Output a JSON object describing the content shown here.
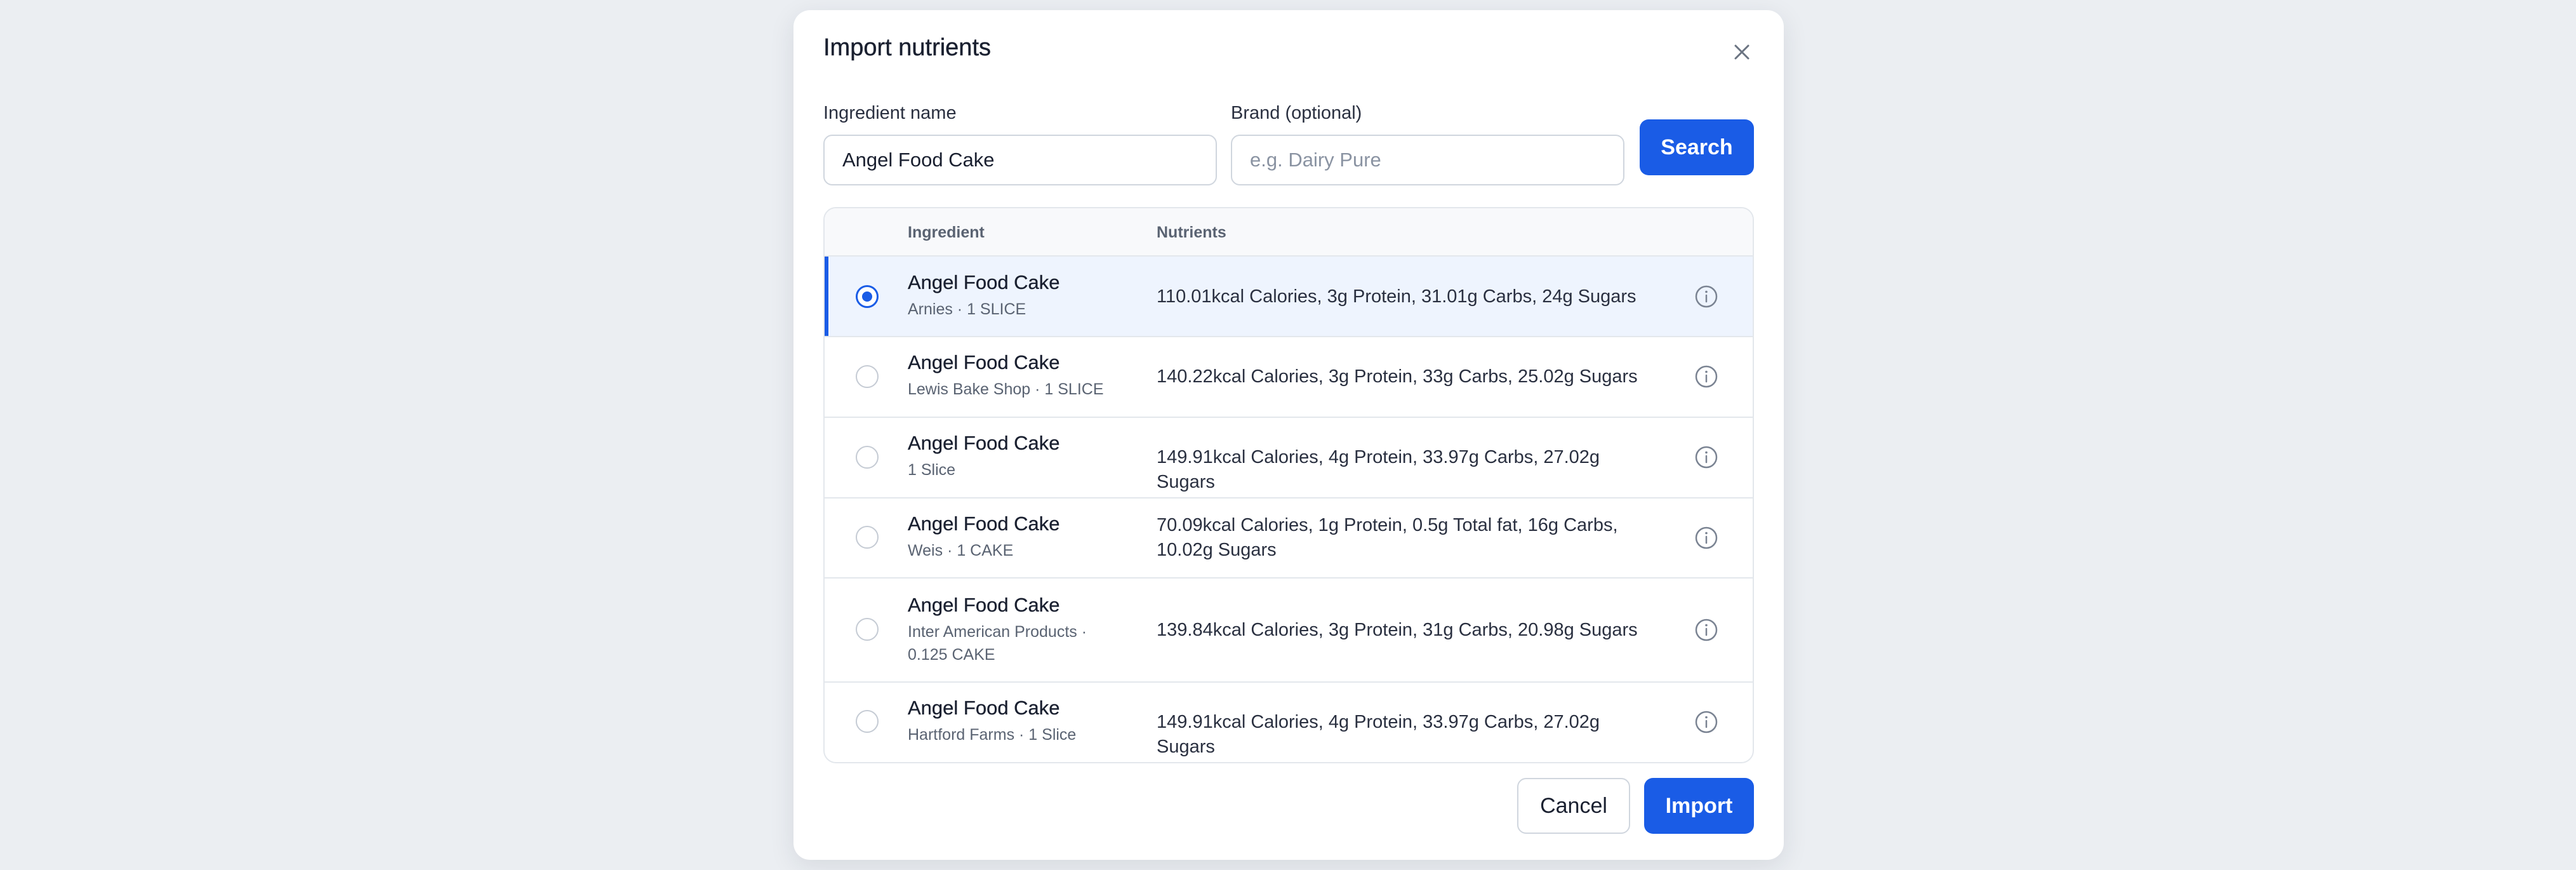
{
  "dialog": {
    "title": "Import nutrients",
    "close_icon": "close-icon"
  },
  "form": {
    "ingredient_label": "Ingredient name",
    "ingredient_value": "Angel Food Cake",
    "brand_label": "Brand (optional)",
    "brand_placeholder": "e.g. Dairy Pure",
    "brand_value": "",
    "search_label": "Search"
  },
  "table": {
    "headers": {
      "ingredient": "Ingredient",
      "nutrients": "Nutrients"
    },
    "rows": [
      {
        "name": "Angel Food Cake",
        "detail": "Arnies · 1 SLICE",
        "nutrients": "110.01kcal Calories, 3g Protein, 31.01g Carbs, 24g Sugars",
        "selected": true
      },
      {
        "name": "Angel Food Cake",
        "detail": "Lewis Bake Shop · 1 SLICE",
        "nutrients": "140.22kcal Calories, 3g Protein, 33g Carbs, 25.02g Sugars",
        "selected": false
      },
      {
        "name": "Angel Food Cake",
        "detail": "1 Slice",
        "nutrients": "149.91kcal Calories, 4g Protein, 33.97g Carbs, 27.02g Sugars",
        "selected": false
      },
      {
        "name": "Angel Food Cake",
        "detail": "Weis · 1 CAKE",
        "nutrients": "70.09kcal Calories, 1g Protein, 0.5g Total fat, 16g Carbs, 10.02g Sugars",
        "selected": false
      },
      {
        "name": "Angel Food Cake",
        "detail": "Inter American Products · 0.125 CAKE",
        "nutrients": "139.84kcal Calories, 3g Protein, 31g Carbs, 20.98g Sugars",
        "selected": false
      },
      {
        "name": "Angel Food Cake",
        "detail": "Hartford Farms · 1 Slice",
        "nutrients": "149.91kcal Calories, 4g Protein, 33.97g Carbs, 27.02g Sugars",
        "selected": false
      }
    ],
    "row_info_icon": "info-icon"
  },
  "footer": {
    "cancel_label": "Cancel",
    "import_label": "Import"
  },
  "colors": {
    "accent": "#1a5ce6",
    "selected_row_bg": "#eef4fe",
    "backdrop": "#ebeef2"
  }
}
